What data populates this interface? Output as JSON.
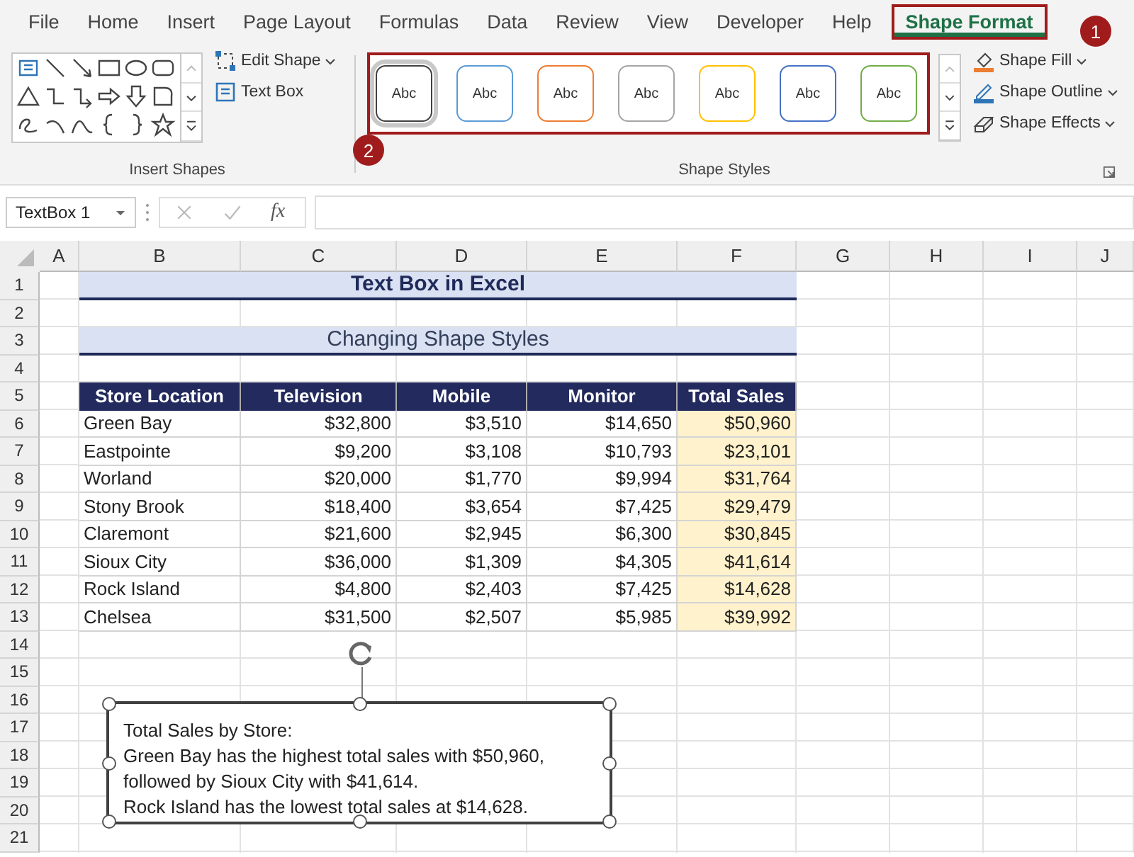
{
  "menu_tabs": [
    {
      "label": "File",
      "selected": false
    },
    {
      "label": "Home",
      "selected": false
    },
    {
      "label": "Insert",
      "selected": false
    },
    {
      "label": "Page Layout",
      "selected": false
    },
    {
      "label": "Formulas",
      "selected": false
    },
    {
      "label": "Data",
      "selected": false
    },
    {
      "label": "Review",
      "selected": false
    },
    {
      "label": "View",
      "selected": false
    },
    {
      "label": "Developer",
      "selected": false
    },
    {
      "label": "Help",
      "selected": false
    },
    {
      "label": "Shape Format",
      "selected": true
    }
  ],
  "callouts": [
    "1",
    "2"
  ],
  "insert_shapes": {
    "buttons": [
      "Edit Shape",
      "Text Box"
    ],
    "group_label": "Insert Shapes"
  },
  "shape_styles": {
    "styles": [
      {
        "label": "Abc",
        "color": "#404040",
        "selected": true
      },
      {
        "label": "Abc",
        "color": "#5b9bd5",
        "selected": false
      },
      {
        "label": "Abc",
        "color": "#ed7d31",
        "selected": false
      },
      {
        "label": "Abc",
        "color": "#a5a5a5",
        "selected": false
      },
      {
        "label": "Abc",
        "color": "#ffc000",
        "selected": false
      },
      {
        "label": "Abc",
        "color": "#4472c4",
        "selected": false
      },
      {
        "label": "Abc",
        "color": "#70ad47",
        "selected": false
      }
    ],
    "buttons": [
      "Shape Fill",
      "Shape Outline",
      "Shape Effects"
    ],
    "group_label": "Shape Styles"
  },
  "formula_bar": {
    "name_box": "TextBox 1",
    "function_label": "fx"
  },
  "columns": [
    "A",
    "B",
    "C",
    "D",
    "E",
    "F",
    "G",
    "H",
    "I",
    "J"
  ],
  "rows": [
    "1",
    "2",
    "3",
    "4",
    "5",
    "6",
    "7",
    "8",
    "9",
    "10",
    "11",
    "12",
    "13",
    "14",
    "15",
    "16",
    "17",
    "18",
    "19",
    "20",
    "21"
  ],
  "sheet": {
    "title": "Text Box in Excel",
    "subtitle": "Changing Shape Styles",
    "table": {
      "columns": [
        "Store Location",
        "Television",
        "Mobile",
        "Monitor",
        "Total Sales"
      ],
      "rows": [
        [
          "Green Bay",
          "$32,800",
          "$3,510",
          "$14,650",
          "$50,960"
        ],
        [
          "Eastpointe",
          "$9,200",
          "$3,108",
          "$10,793",
          "$23,101"
        ],
        [
          "Worland",
          "$20,000",
          "$1,770",
          "$9,994",
          "$31,764"
        ],
        [
          "Stony Brook",
          "$18,400",
          "$3,654",
          "$7,425",
          "$29,479"
        ],
        [
          "Claremont",
          "$21,600",
          "$2,945",
          "$6,300",
          "$30,845"
        ],
        [
          "Sioux City",
          "$36,000",
          "$1,309",
          "$4,305",
          "$41,614"
        ],
        [
          "Rock Island",
          "$4,800",
          "$2,403",
          "$7,425",
          "$14,628"
        ],
        [
          "Chelsea",
          "$31,500",
          "$2,507",
          "$5,985",
          "$39,992"
        ]
      ]
    }
  },
  "text_box": {
    "lines": [
      "Total Sales by Store:",
      "Green Bay has the highest total sales with $50,960,",
      "followed by Sioux City with $41,614.",
      "Rock Island has the lowest total sales at $14,628."
    ]
  }
}
